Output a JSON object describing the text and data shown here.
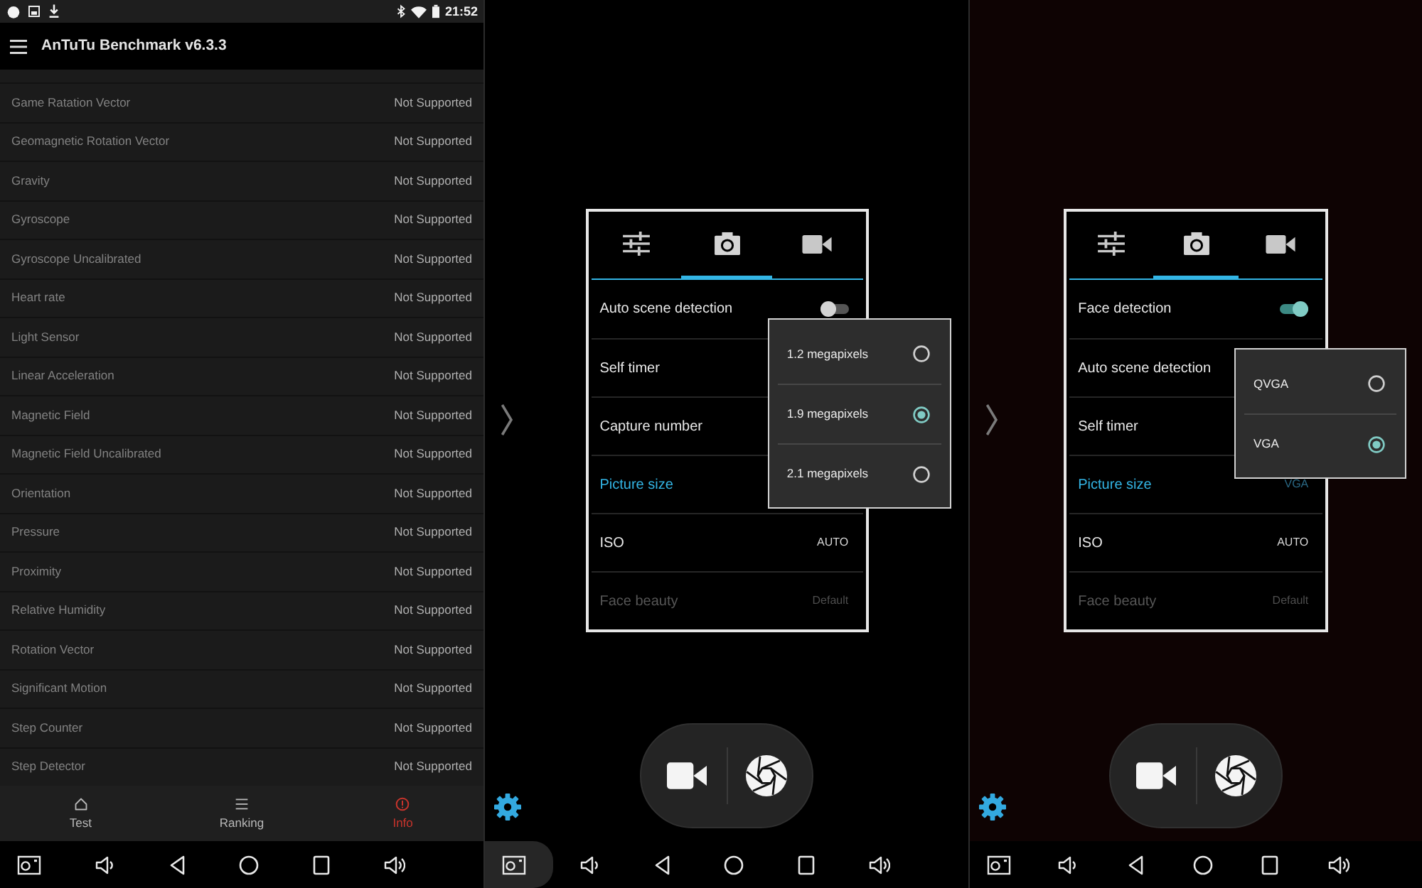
{
  "status_bar": {
    "time": "21:52"
  },
  "antutu": {
    "title": "AnTuTu Benchmark v6.3.3",
    "sensors": [
      {
        "name": "Game Ratation Vector",
        "status": "Not Supported"
      },
      {
        "name": "Geomagnetic Rotation Vector",
        "status": "Not Supported"
      },
      {
        "name": "Gravity",
        "status": "Not Supported"
      },
      {
        "name": "Gyroscope",
        "status": "Not Supported"
      },
      {
        "name": "Gyroscope Uncalibrated",
        "status": "Not Supported"
      },
      {
        "name": "Heart rate",
        "status": "Not Supported"
      },
      {
        "name": "Light Sensor",
        "status": "Not Supported"
      },
      {
        "name": "Linear Acceleration",
        "status": "Not Supported"
      },
      {
        "name": "Magnetic Field",
        "status": "Not Supported"
      },
      {
        "name": "Magnetic Field Uncalibrated",
        "status": "Not Supported"
      },
      {
        "name": "Orientation",
        "status": "Not Supported"
      },
      {
        "name": "Pressure",
        "status": "Not Supported"
      },
      {
        "name": "Proximity",
        "status": "Not Supported"
      },
      {
        "name": "Relative Humidity",
        "status": "Not Supported"
      },
      {
        "name": "Rotation Vector",
        "status": "Not Supported"
      },
      {
        "name": "Significant Motion",
        "status": "Not Supported"
      },
      {
        "name": "Step Counter",
        "status": "Not Supported"
      },
      {
        "name": "Step Detector",
        "status": "Not Supported"
      }
    ],
    "bottom_tabs": [
      {
        "label": "Test",
        "kind": "home",
        "selected": false
      },
      {
        "label": "Ranking",
        "kind": "list",
        "selected": false
      },
      {
        "label": "Info",
        "kind": "info",
        "selected": true
      }
    ]
  },
  "camera_screens": [
    {
      "tabs": [
        {
          "kind": "settings",
          "selected": false
        },
        {
          "kind": "photo",
          "selected": true
        },
        {
          "kind": "video",
          "selected": false
        }
      ],
      "settings": [
        {
          "label": "Auto scene detection",
          "kind": "toggle",
          "on": false,
          "selected": false,
          "disabled": false
        },
        {
          "label": "Self timer",
          "kind": "value",
          "selected": false,
          "disabled": false
        },
        {
          "label": "Capture number",
          "kind": "value",
          "selected": false,
          "disabled": false
        },
        {
          "label": "Picture size",
          "kind": "value",
          "selected": true,
          "disabled": false
        },
        {
          "label": "ISO",
          "kind": "value",
          "value": "AUTO",
          "selected": false,
          "disabled": false
        },
        {
          "label": "Face beauty",
          "kind": "value",
          "value": "Default",
          "selected": false,
          "disabled": true
        }
      ],
      "options": [
        {
          "label": "1.2 megapixels",
          "selected": false
        },
        {
          "label": "1.9 megapixels",
          "selected": true
        },
        {
          "label": "2.1 megapixels",
          "selected": false
        }
      ]
    },
    {
      "tabs": [
        {
          "kind": "settings",
          "selected": false
        },
        {
          "kind": "photo",
          "selected": true
        },
        {
          "kind": "video",
          "selected": false
        }
      ],
      "settings": [
        {
          "label": "Face detection",
          "kind": "toggle",
          "on": true,
          "selected": false,
          "disabled": false
        },
        {
          "label": "Auto scene detection",
          "kind": "value",
          "selected": false,
          "disabled": false
        },
        {
          "label": "Self timer",
          "kind": "value",
          "selected": false,
          "disabled": false
        },
        {
          "label": "Picture size",
          "kind": "value",
          "value": "VGA",
          "selected": true,
          "disabled": false
        },
        {
          "label": "ISO",
          "kind": "value",
          "value": "AUTO",
          "selected": false,
          "disabled": false
        },
        {
          "label": "Face beauty",
          "kind": "value",
          "value": "Default",
          "selected": false,
          "disabled": true
        }
      ],
      "options": [
        {
          "label": "QVGA",
          "selected": false
        },
        {
          "label": "VGA",
          "selected": true
        }
      ]
    }
  ],
  "nav_bars": [
    {
      "screenshot_pressed": false
    },
    {
      "screenshot_pressed": true
    },
    {
      "screenshot_pressed": false
    }
  ]
}
